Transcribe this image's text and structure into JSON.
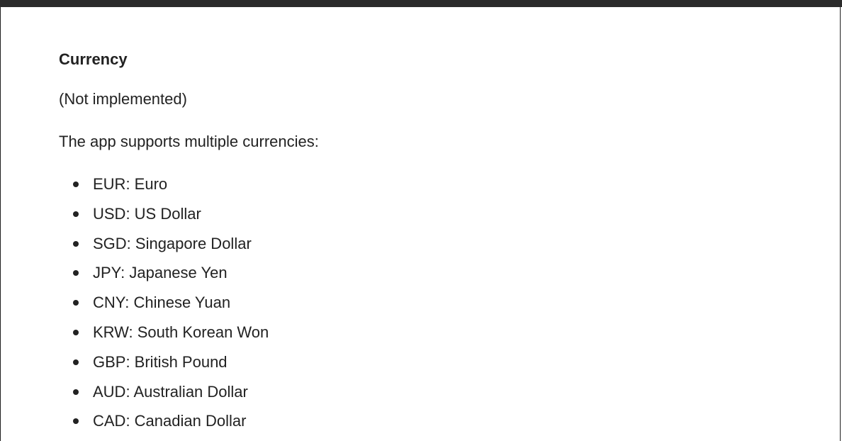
{
  "section": {
    "heading": "Currency",
    "note": "(Not implemented)",
    "intro": "The app supports multiple currencies:"
  },
  "currencies": [
    {
      "text": "EUR: Euro"
    },
    {
      "text": "USD: US Dollar"
    },
    {
      "text": "SGD: Singapore Dollar"
    },
    {
      "text": "JPY: Japanese Yen"
    },
    {
      "text": "CNY: Chinese Yuan"
    },
    {
      "text": "KRW: South Korean Won"
    },
    {
      "text": "GBP: British Pound"
    },
    {
      "text": "AUD: Australian Dollar"
    },
    {
      "text": "CAD: Canadian Dollar"
    }
  ]
}
